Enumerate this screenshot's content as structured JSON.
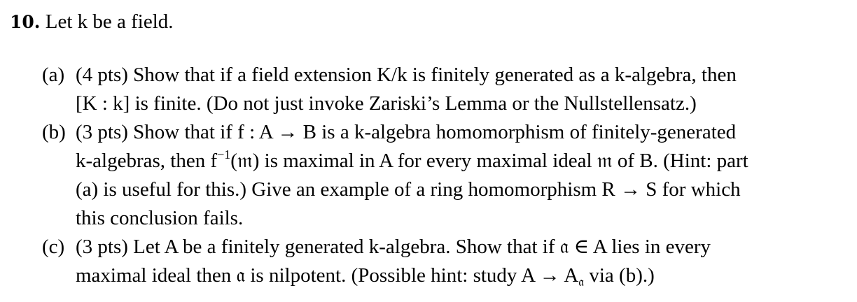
{
  "problem": {
    "number": "10.",
    "statement": "Let k be a field."
  },
  "parts": [
    {
      "label": "(a)",
      "lines": [
        "(4 pts) Show that if a field extension K/k is finitely generated as a k-algebra, then",
        "[K : k] is finite. (Do not just invoke Zariski’s Lemma or the Nullstellensatz.)"
      ]
    },
    {
      "label": "(b)",
      "lines": [
        "(3 pts) Show that if f : A → B is a k-algebra homomorphism of finitely-generated",
        "k-algebras, then f",
        "−1",
        "(𝔪) is maximal in A for every maximal ideal 𝔪 of B. (Hint: part",
        "(a) is useful for this.) Give an example of a ring homomorphism R → S for which",
        "this conclusion fails."
      ]
    },
    {
      "label": "(c)",
      "lines": [
        "(3 pts) Let A be a finitely generated k-algebra. Show that if 𝔞 ∈ A lies in every",
        "maximal ideal then 𝔞 is nilpotent. (Possible hint: study A → A",
        "𝔞",
        " via (b).)"
      ]
    }
  ]
}
